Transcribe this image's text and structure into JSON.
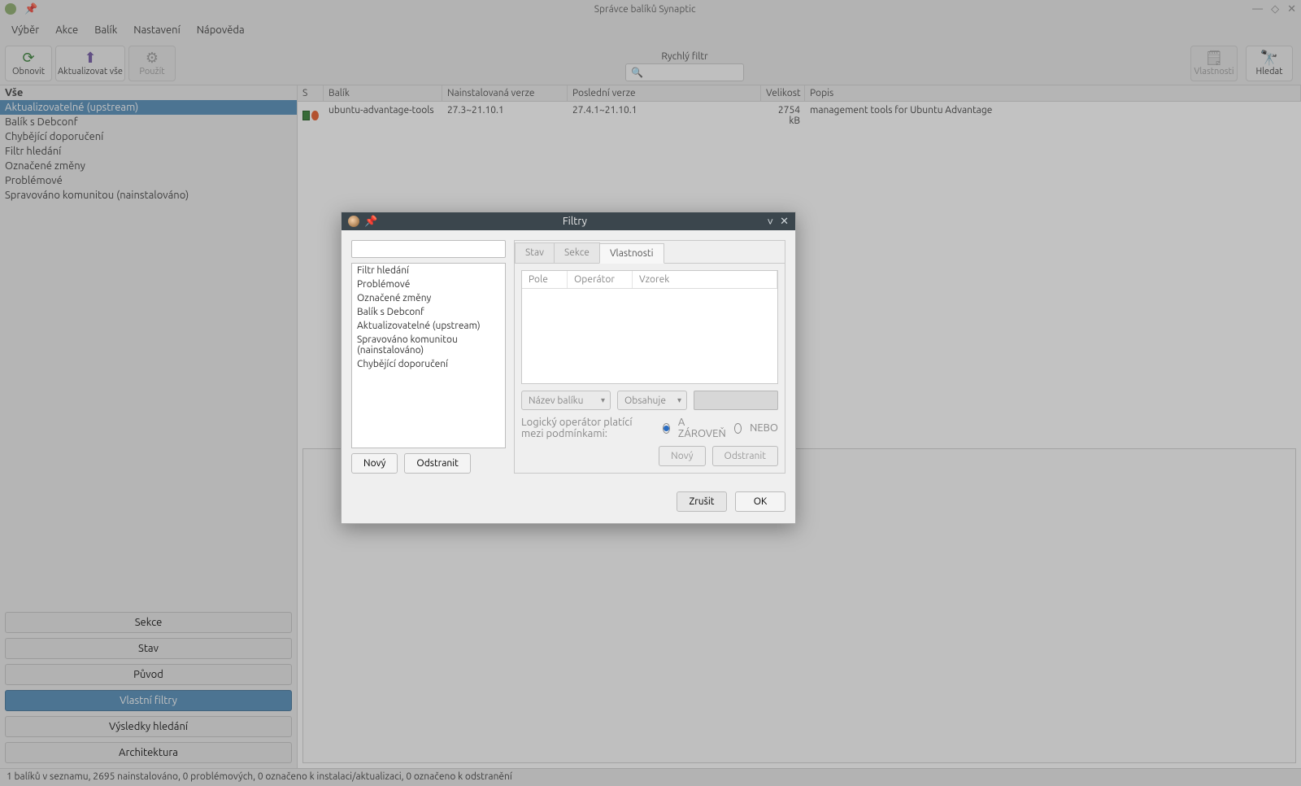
{
  "window": {
    "title": "Správce balíků Synaptic",
    "menu": [
      "Výběr",
      "Akce",
      "Balík",
      "Nastavení",
      "Nápověda"
    ],
    "toolbar": {
      "refresh": "Obnovit",
      "update_all": "Aktualizovat vše",
      "apply": "Použít",
      "properties": "Vlastnosti",
      "search": "Hledat",
      "quick_label": "Rychlý filtr"
    },
    "statusbar": "1 balíků v seznamu, 2695 nainstalováno, 0 problémových, 0 označeno k instalaci/aktualizaci, 0 označeno k odstranění",
    "win_controls": {
      "min": "—",
      "max": "◇",
      "close": "✕"
    }
  },
  "sidebar": {
    "header": "Vše",
    "items": [
      "Aktualizovatelné (upstream)",
      "Balík s Debconf",
      "Chybějící doporučení",
      "Filtr hledání",
      "Označené změny",
      "Problémové",
      "Spravováno komunitou (nainstalováno)"
    ],
    "buttons": {
      "sections": "Sekce",
      "status": "Stav",
      "origin": "Původ",
      "custom": "Vlastní filtry",
      "results": "Výsledky hledání",
      "arch": "Architektura"
    }
  },
  "packages": {
    "columns": {
      "s": "S",
      "name": "Balík",
      "installed": "Nainstalovaná verze",
      "latest": "Poslední verze",
      "size": "Velikost",
      "desc": "Popis"
    },
    "rows": [
      {
        "name": "ubuntu-advantage-tools",
        "installed": "27.3~21.10.1",
        "latest": "27.4.1~21.10.1",
        "size": "2754 kB",
        "desc": "management tools for Ubuntu Advantage"
      }
    ]
  },
  "dialog": {
    "title": "Filtry",
    "filters": [
      "Filtr hledání",
      "Problémové",
      "Označené změny",
      "Balík s Debconf",
      "Aktualizovatelné (upstream)",
      "Spravováno komunitou (nainstalováno)",
      "Chybějící doporučení"
    ],
    "left_buttons": {
      "new": "Nový",
      "remove": "Odstranit"
    },
    "tabs": {
      "status": "Stav",
      "section": "Sekce",
      "properties": "Vlastnosti"
    },
    "prop_cols": {
      "field": "Pole",
      "operator": "Operátor",
      "pattern": "Vzorek"
    },
    "dropdowns": {
      "field": "Název balíku",
      "op": "Obsahuje"
    },
    "logic_label": "Logický operátor platící mezi podmínkami:",
    "radio_and": "A ZÁROVEŇ",
    "radio_or": "NEBO",
    "right_buttons": {
      "new": "Nový",
      "remove": "Odstranit"
    },
    "footer": {
      "cancel": "Zrušit",
      "ok": "OK"
    }
  }
}
